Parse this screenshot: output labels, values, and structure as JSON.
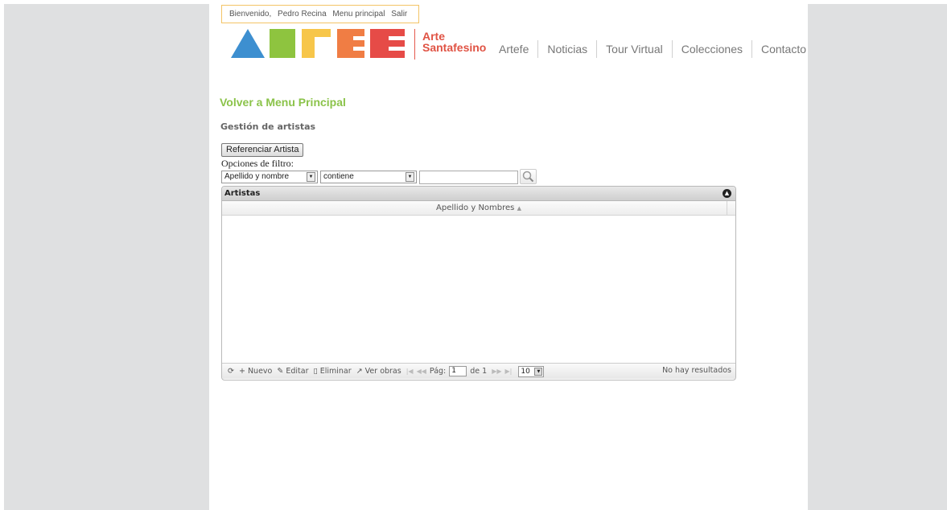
{
  "header": {
    "welcome": "Bienvenido,",
    "user_name": "Pedro Recina",
    "menu_link": "Menu principal",
    "logout_link": "Salir",
    "brand_line1": "Arte",
    "brand_line2": "Santafesino",
    "logo_colors": [
      "#3d8fd0",
      "#8ec43f",
      "#f7c64a",
      "#f07d44",
      "#e64b47"
    ],
    "nav": [
      "Artefe",
      "Noticias",
      "Tour Virtual",
      "Colecciones",
      "Contacto"
    ]
  },
  "main": {
    "back_link": "Volver a Menu Principal",
    "section_title": "Gestión de artistas",
    "reference_button": "Referenciar Artista",
    "filter_label": "Opciones de filtro:",
    "filter_field": "Apellido y nombre",
    "filter_operator": "contiene",
    "search_value": ""
  },
  "grid": {
    "title": "Artistas",
    "column": "Apellido y Nombres",
    "sort_icon": "sort-asc-icon",
    "pager": {
      "nuevo": "Nuevo",
      "editar": "Editar",
      "eliminar": "Eliminar",
      "ver_obras": "Ver obras",
      "page_label": "Pág:",
      "page": "1",
      "of_label": "de 1",
      "page_size": "10",
      "status": "No hay resultados"
    }
  }
}
